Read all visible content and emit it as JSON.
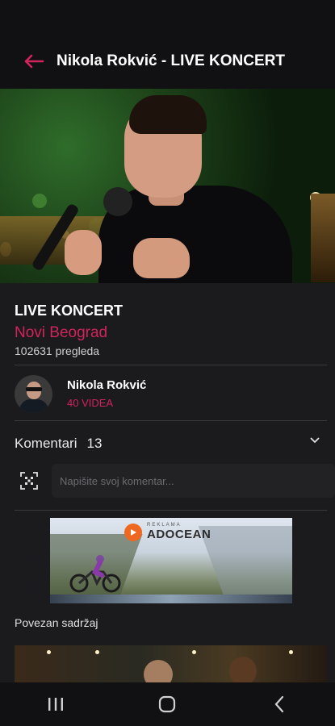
{
  "header": {
    "title": "Nikola Rokvić - LIVE KONCERT",
    "back_icon": "arrow-left-icon",
    "accent": "#d2245c"
  },
  "video": {
    "title": "LIVE KONCERT",
    "location": "Novi Beograd",
    "views": "102631 pregleda"
  },
  "channel": {
    "name": "Nikola Rokvić",
    "video_count": "40 VIDEA"
  },
  "comments": {
    "label": "Komentari",
    "count": "13",
    "placeholder": "Napišite svoj komentar..."
  },
  "ad": {
    "small_text": "REKLAMA",
    "brand": "ADOCEAN"
  },
  "related": {
    "label": "Povezan sadržaj"
  },
  "nav": {
    "recents_icon": "recents-icon",
    "home_icon": "home-icon",
    "back_icon": "back-chevron-icon"
  }
}
